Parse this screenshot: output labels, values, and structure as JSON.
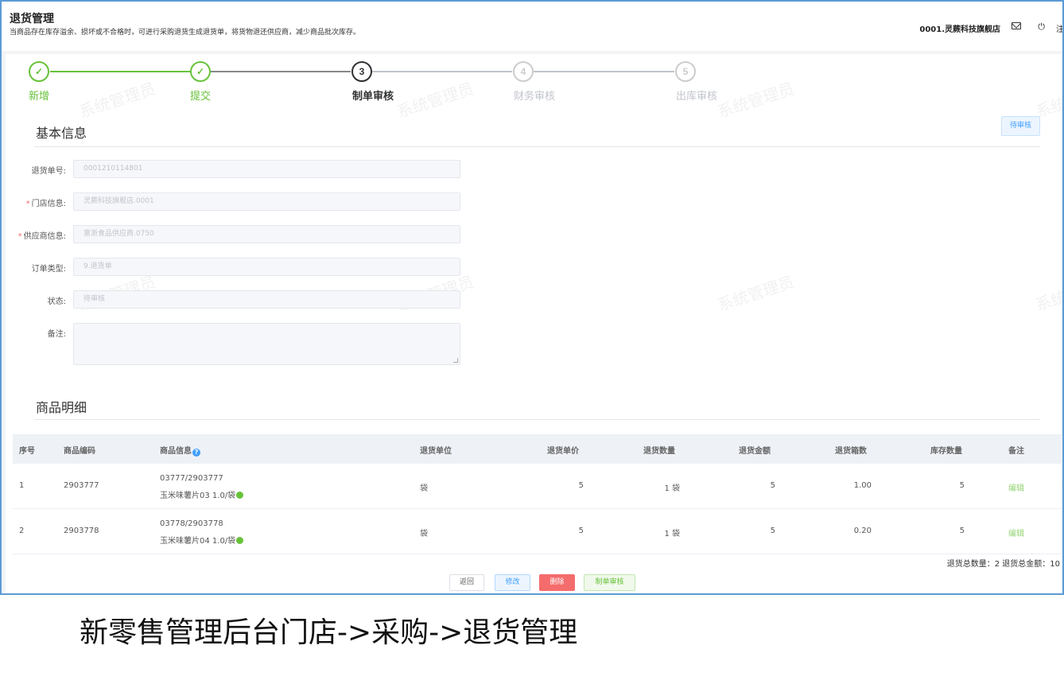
{
  "header": {
    "title": "退货管理",
    "description": "当商品存在库存溢余、损坏或不合格时，可进行采购退货生成退货单，将货物退还供应商，减少商品批次库存。",
    "store": "0001.灵蕨科技旗舰店",
    "logout_label": "注",
    "icons": [
      "mail-icon",
      "power-icon"
    ]
  },
  "steps": [
    {
      "num": "1",
      "label": "新增",
      "status": "done"
    },
    {
      "num": "2",
      "label": "提交",
      "status": "done"
    },
    {
      "num": "3",
      "label": "制单审核",
      "status": "active"
    },
    {
      "num": "4",
      "label": "财务审核",
      "status": "pending"
    },
    {
      "num": "5",
      "label": "出库审核",
      "status": "pending"
    }
  ],
  "basic_info": {
    "title": "基本信息",
    "status_button": "待审核",
    "fields": [
      {
        "label": "退货单号:",
        "value": "0001210114801",
        "required": false
      },
      {
        "label": "门店信息:",
        "value": "灵蕨科技旗舰店.0001",
        "required": true
      },
      {
        "label": "供应商信息:",
        "value": "富浙食品供应商.0750",
        "required": true
      },
      {
        "label": "订单类型:",
        "value": "9.退货单",
        "required": false
      },
      {
        "label": "状态:",
        "value": "待审核",
        "required": false
      }
    ],
    "remark_label": "备注:",
    "remark_value": ""
  },
  "detail": {
    "title": "商品明细",
    "columns": [
      "序号",
      "商品编码",
      "商品信息",
      "退货单位",
      "退货单价",
      "退货数量",
      "退货金额",
      "退货箱数",
      "库存数量",
      "备注"
    ],
    "rows": [
      {
        "idx": "1",
        "code": "2903777",
        "info1": "03777/2903777",
        "info2": "玉米味薯片03 1.0/袋",
        "unit": "袋",
        "price": "5",
        "qty": "1 袋",
        "amount": "5",
        "boxes": "1.00",
        "stock": "5",
        "action": "编辑"
      },
      {
        "idx": "2",
        "code": "2903778",
        "info1": "03778/2903778",
        "info2": "玉米味薯片04 1.0/袋",
        "unit": "袋",
        "price": "5",
        "qty": "1 袋",
        "amount": "5",
        "boxes": "0.20",
        "stock": "5",
        "action": "编辑"
      }
    ],
    "summary": "退货总数量：2 退货总金额：10"
  },
  "buttons": {
    "back": "返回",
    "edit": "修改",
    "delete": "删除",
    "audit": "制单审核"
  },
  "watermark": "系统管理员",
  "caption": "新零售管理后台门店->采购->退货管理",
  "colors": {
    "done": "#67c23a",
    "active": "#303133",
    "pending": "#c0c4cc",
    "primary": "#409eff",
    "danger": "#f56c6c"
  }
}
